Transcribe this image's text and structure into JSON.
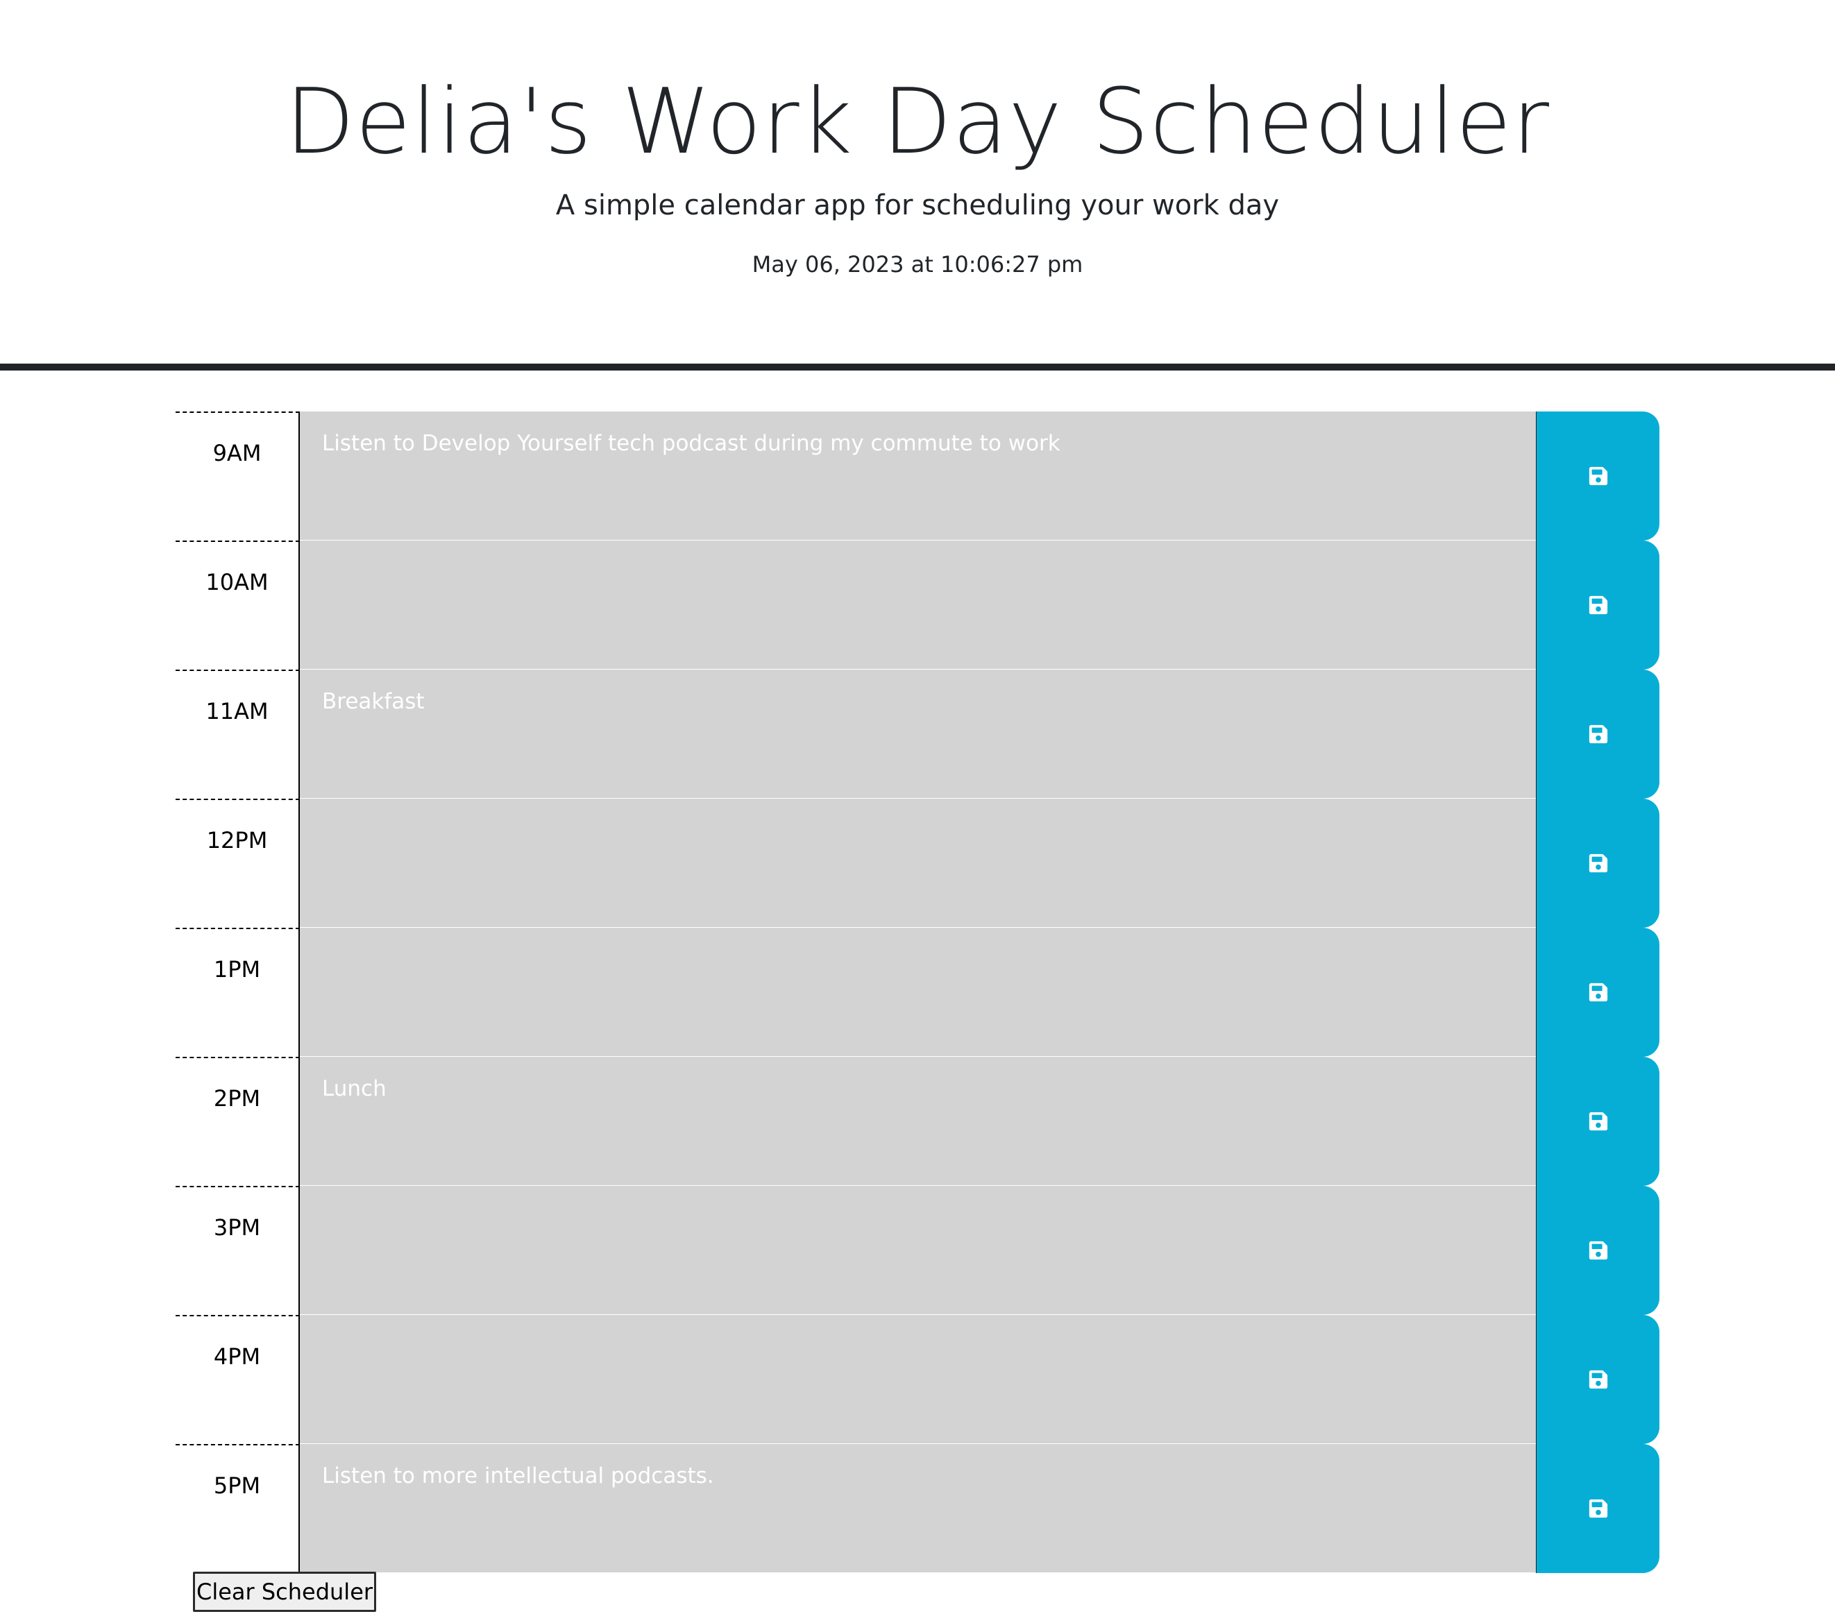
{
  "header": {
    "title": "Delia's Work Day Scheduler",
    "subtitle": "A simple calendar app for scheduling your work day",
    "current_datetime": "May 06, 2023 at 10:06:27 pm"
  },
  "colors": {
    "past_block": "#d3d3d3",
    "save_button": "#06aed5",
    "header_rule": "#212529"
  },
  "time_blocks": [
    {
      "hour": "9AM",
      "description": "Listen to Develop Yourself tech podcast during my commute to work",
      "save_icon": "floppy-disk-icon"
    },
    {
      "hour": "10AM",
      "description": "",
      "save_icon": "floppy-disk-icon"
    },
    {
      "hour": "11AM",
      "description": "Breakfast",
      "save_icon": "floppy-disk-icon"
    },
    {
      "hour": "12PM",
      "description": "",
      "save_icon": "floppy-disk-icon"
    },
    {
      "hour": "1PM",
      "description": "",
      "save_icon": "floppy-disk-icon"
    },
    {
      "hour": "2PM",
      "description": "Lunch",
      "save_icon": "floppy-disk-icon"
    },
    {
      "hour": "3PM",
      "description": "",
      "save_icon": "floppy-disk-icon"
    },
    {
      "hour": "4PM",
      "description": "",
      "save_icon": "floppy-disk-icon"
    },
    {
      "hour": "5PM",
      "description": "Listen to more intellectual podcasts.",
      "save_icon": "floppy-disk-icon"
    }
  ],
  "clear_button_label": "Clear Scheduler"
}
